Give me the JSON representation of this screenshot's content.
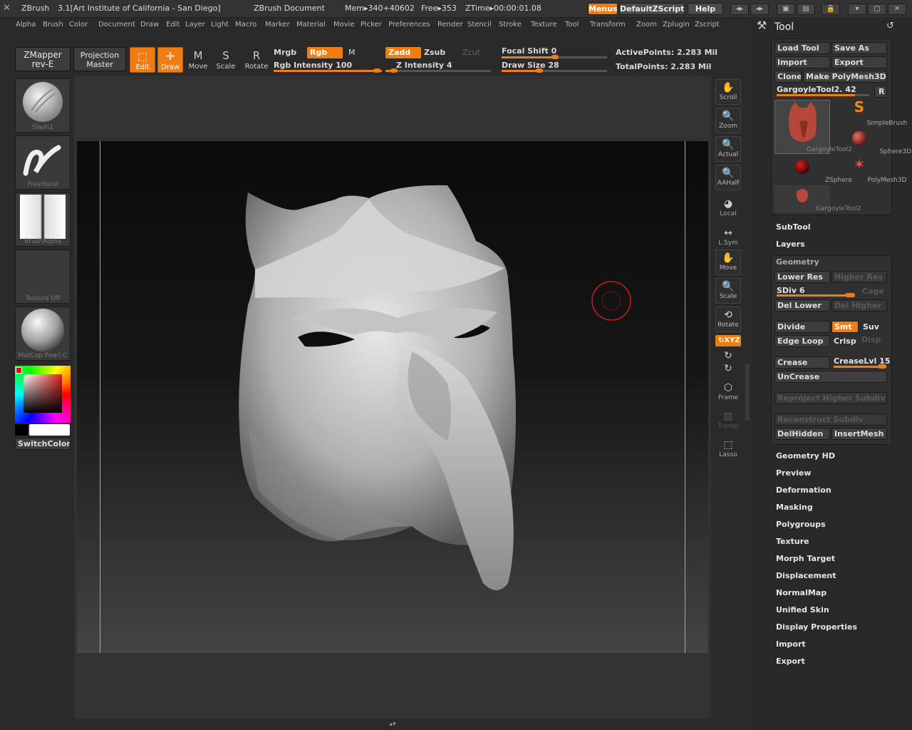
{
  "titlebar": {
    "app_name": "ZBrush",
    "version_info": "3.1[Art Institute of California - San Diego]",
    "document": "ZBrush Document",
    "mem": "Mem▸340+40602",
    "free": "Free▸353",
    "ztime": "ZTime▸00:00:01.08",
    "menus_label": "Menus",
    "zscript_label": "DefaultZScript",
    "help_label": "Help"
  },
  "menubar": [
    "Alpha",
    "Brush",
    "Color",
    "Document",
    "Draw",
    "Edit",
    "Layer",
    "Light",
    "Macro",
    "Marker",
    "Material",
    "Movie",
    "Picker",
    "Preferences",
    "Render",
    "Stencil",
    "Stroke",
    "Texture",
    "Tool",
    "Transform",
    "Zoom",
    "Zplugin",
    "Zscript"
  ],
  "toolbar": {
    "zmapper_line1": "ZMapper",
    "zmapper_line2": "rev-E",
    "projection_line1": "Projection",
    "projection_line2": "Master",
    "edit_label": "Edit",
    "draw_label": "Draw",
    "move_label": "Move",
    "scale_label": "Scale",
    "rotate_label": "Rotate",
    "mrgb_label": "Mrgb",
    "rgb_label": "Rgb",
    "m_label": "M",
    "rgb_intensity_label": "Rgb Intensity 100",
    "zadd_label": "Zadd",
    "zsub_label": "Zsub",
    "zcut_label": "Zcut",
    "z_intensity_label": "Z Intensity 4",
    "focal_shift_label": "Focal Shift 0",
    "draw_size_label": "Draw Size 28",
    "active_points": "ActivePoints: 2.283 Mil",
    "total_points": "TotalPoints: 2.283 Mil"
  },
  "shelf": {
    "brush_label": "Slash1",
    "stroke_label": "FreeHand",
    "alpha_label": "BrushAlpha",
    "texture_label": "Texture Off",
    "material_label": "MatCap Pearl C",
    "switch_color_label": "SwitchColor"
  },
  "nav": {
    "scroll": "Scroll",
    "zoom": "Zoom",
    "actual": "Actual",
    "aahalf": "AAHalf",
    "local": "Local",
    "lsym": "L.Sym",
    "move": "Move",
    "scale": "Scale",
    "rotate": "Rotate",
    "xyz": "↻XYZ",
    "frame": "Frame",
    "transp": "Transp",
    "lasso": "Lasso"
  },
  "tool_panel": {
    "title": "Tool",
    "load_tool": "Load Tool",
    "save_as": "Save As",
    "import": "Import",
    "export": "Export",
    "clone": "Clone",
    "make_polymesh": "Make PolyMesh3D",
    "current_tool": "GargoyleTool2. 42",
    "r_label": "R",
    "thumbs": [
      "GargoyleTool2",
      "SimpleBrush",
      "Sphere3D",
      "ZSphere",
      "PolyMesh3D",
      "GargoyleTool2"
    ],
    "subtool": "SubTool",
    "layers": "Layers",
    "geometry": "Geometry",
    "lower_res": "Lower Res",
    "higher_res": "Higher Res",
    "sdiv": "SDiv 6",
    "cage": "Cage",
    "del_lower": "Del Lower",
    "del_higher": "Del Higher",
    "divide": "Divide",
    "smt": "Smt",
    "suv": "Suv",
    "edge_loop": "Edge Loop",
    "crisp": "Crisp",
    "disp": "Disp",
    "crease": "Crease",
    "crease_lvl": "CreaseLvl 15",
    "uncrease": "UnCrease",
    "reproject": "Reproject Higher Subdiv",
    "reconstruct": "Reconstruct Subdiv",
    "del_hidden": "DelHidden",
    "insert_mesh": "InsertMesh",
    "sections": [
      "Geometry HD",
      "Preview",
      "Deformation",
      "Masking",
      "Polygroups",
      "Texture",
      "Morph Target",
      "Displacement",
      "NormalMap",
      "Unified Skin",
      "Display Properties",
      "Import",
      "Export"
    ]
  },
  "colors": {
    "accent": "#f07c14",
    "background": "#2a2a2a",
    "cursor_ring": "#c81e1e"
  }
}
